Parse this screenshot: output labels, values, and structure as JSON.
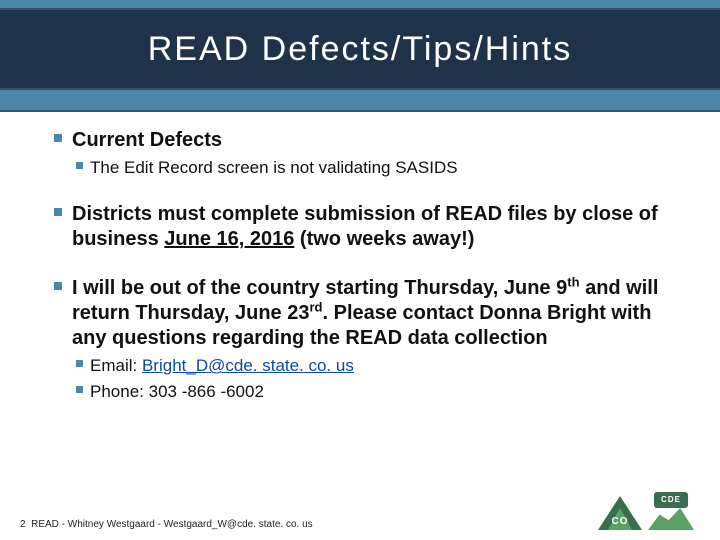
{
  "title": "READ Defects/Tips/Hints",
  "bullets": {
    "a": "Current Defects",
    "a1": "The Edit Record screen is not validating SASIDS",
    "b_pre": "Districts must complete submission of READ files by close of business ",
    "b_mid": "June 16, 2016",
    "b_post": " (two weeks away!)",
    "c1": "I will be out of the country starting Thursday, June 9",
    "c1_sup": "th",
    "c2": " and will return Thursday, June 23",
    "c2_sup": "rd",
    "c3": ". Please contact Donna Bright with any questions regarding the READ data collection",
    "email_label": "Email: ",
    "email": "Bright_D@cde. state. co. us",
    "phone_label": "Phone: ",
    "phone": "303 -866 -6002"
  },
  "footer": {
    "page": "2",
    "text": "READ - Whitney Westgaard - Westgaard_W@cde. state. co. us"
  },
  "logo": {
    "cde": "CDE",
    "co": "CO"
  }
}
